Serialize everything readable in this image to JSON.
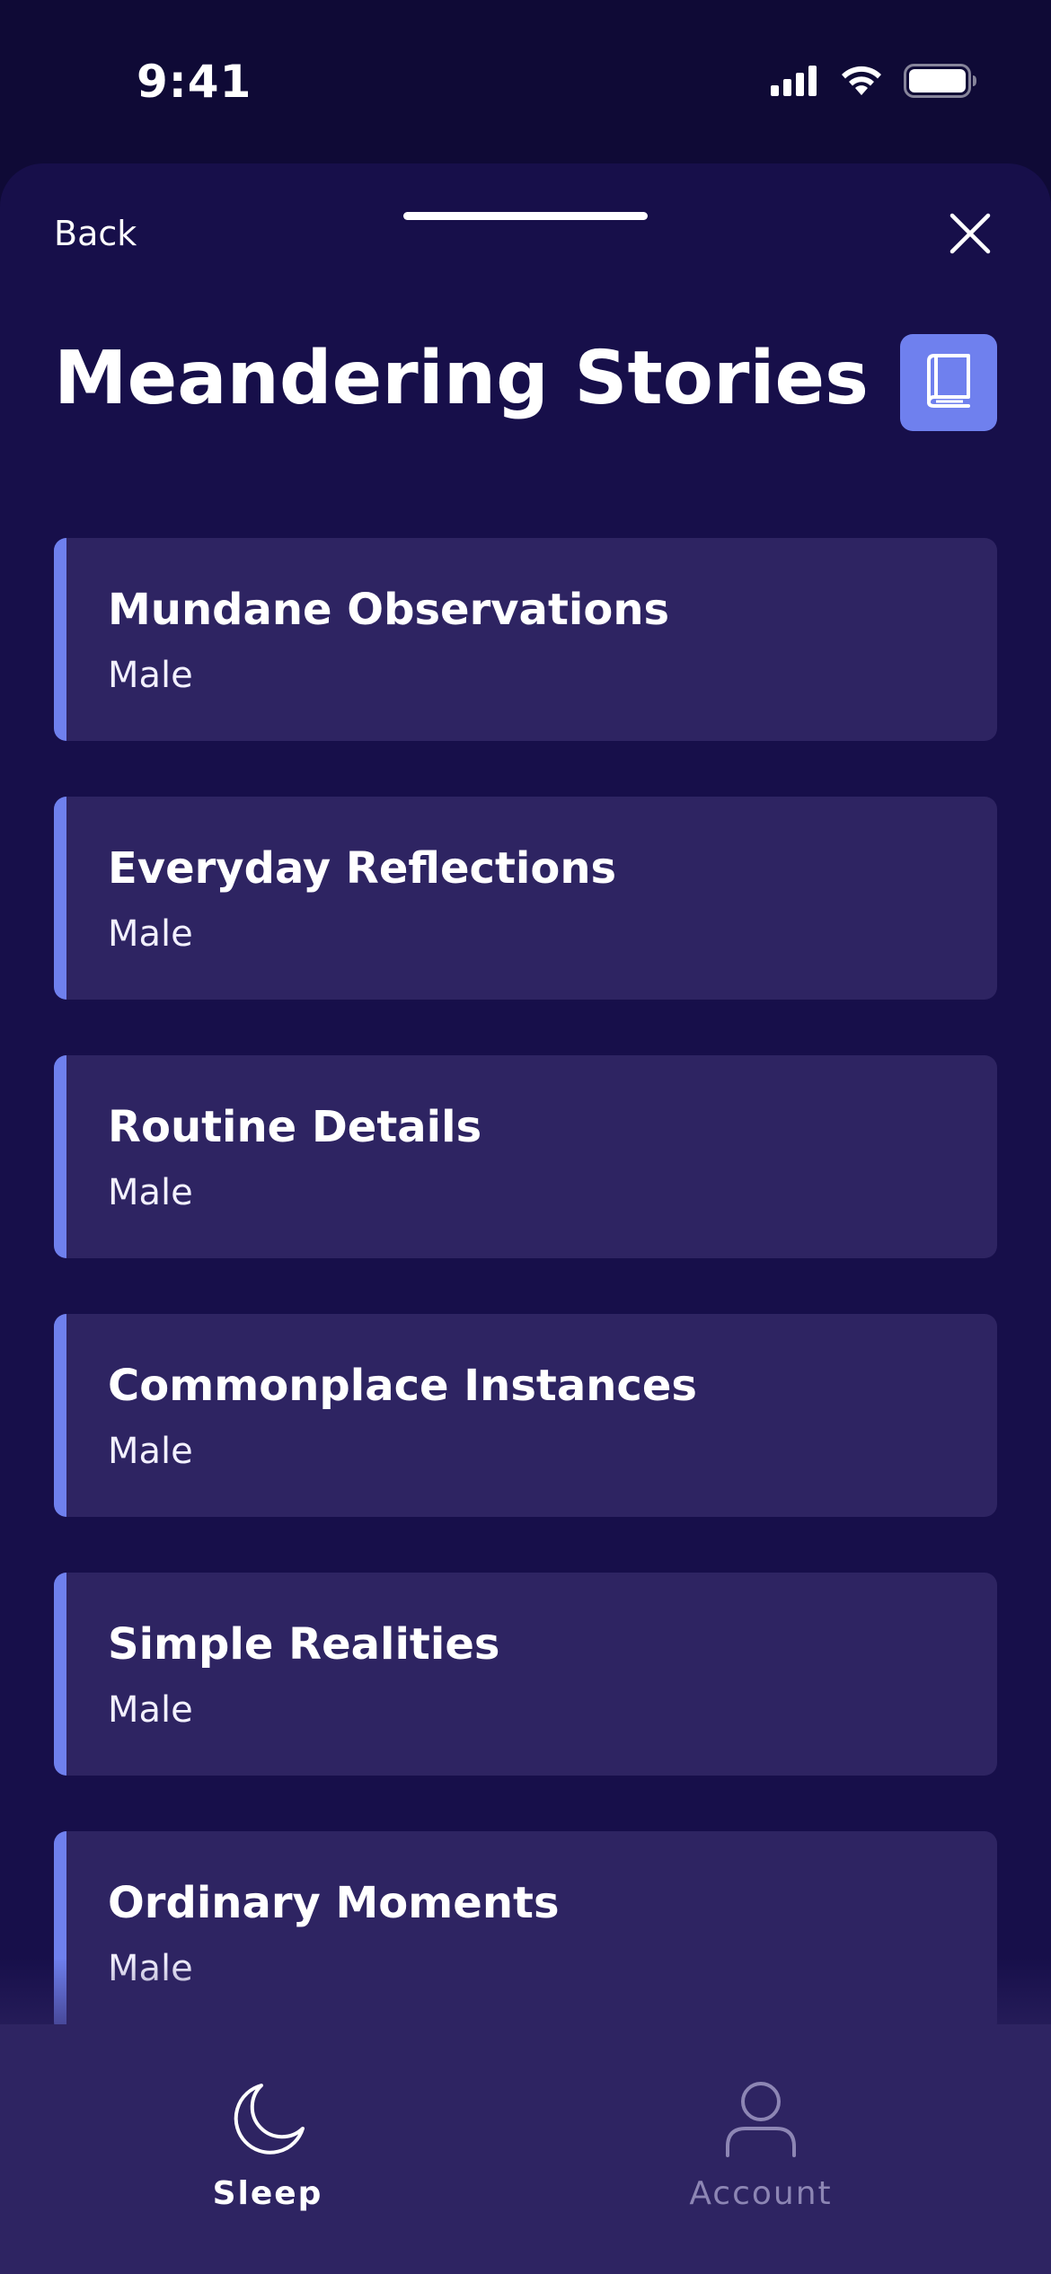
{
  "status_bar": {
    "time": "9:41",
    "icons": [
      "cellular-signal-icon",
      "wifi-icon",
      "battery-icon"
    ]
  },
  "header": {
    "back_label": "Back",
    "title": "Meandering Stories",
    "close_icon": "close-icon",
    "action_icon": "book-icon"
  },
  "stories": [
    {
      "title": "Mundane Observations",
      "voice": "Male"
    },
    {
      "title": "Everyday Reflections",
      "voice": "Male"
    },
    {
      "title": "Routine Details",
      "voice": "Male"
    },
    {
      "title": "Commonplace Instances",
      "voice": "Male"
    },
    {
      "title": "Simple Realities",
      "voice": "Male"
    },
    {
      "title": "Ordinary Moments",
      "voice": "Male"
    }
  ],
  "tab_bar": {
    "tabs": [
      {
        "label": "Sleep",
        "icon": "moon-icon",
        "active": true
      },
      {
        "label": "Account",
        "icon": "person-icon",
        "active": false
      }
    ]
  },
  "colors": {
    "background": "#0f0a36",
    "sheet": "#170f4a",
    "card": "#2e2462",
    "accent": "#6f80ee",
    "inactive_tab": "#8d86b4"
  }
}
